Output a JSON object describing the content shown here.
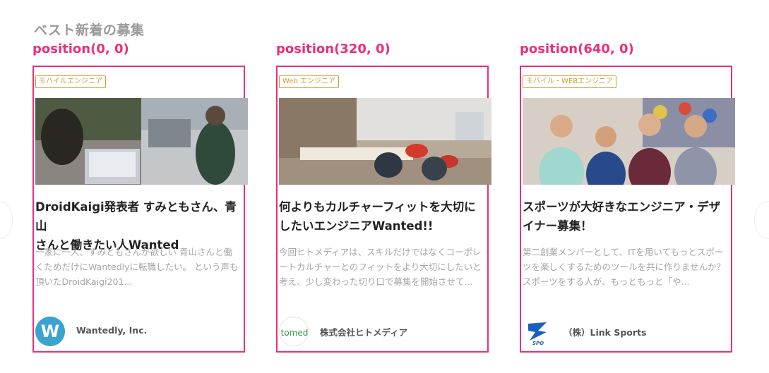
{
  "section": {
    "title": "ベスト新着の募集"
  },
  "cards": [
    {
      "position_label": "position(0, 0)",
      "tag": "モバイルエンジニア",
      "title_line1": "DroidKaigi発表者 すみともさん、青山",
      "title_line2": "さんと働きたい人Wanted",
      "desc_line1": "一家に一人、すみともさんが欲しい 青山さんと働",
      "desc_line2": "くためだけにWantedlyに転職したい。 という声も",
      "desc_line3": "頂いたDroidKaigi201...",
      "company": "Wantedly, Inc.",
      "logo_icon": "wantedly-w-icon",
      "logo_color": "#2f9ac9"
    },
    {
      "position_label": "position(320, 0)",
      "tag": "Web エンジニア",
      "title_line1": "何よりもカルチャーフィットを大切に",
      "title_line2": "したいエンジニアWanted!!",
      "desc_line1": "今回ヒトメディアは、スキルだけではなくコーポレ",
      "desc_line2": "ートカルチャーとのフィットをより大切にしたいと",
      "desc_line3": "考え、少し変わった切り口で募集を開始させて...",
      "company": "株式会社ヒトメディア",
      "logo_text": "tomed",
      "logo_color": "#2e9a4e"
    },
    {
      "position_label": "position(640, 0)",
      "tag": "モバイル・WEBエンジニア",
      "title_line1": "スポーツが大好きなエンジニア・デザ",
      "title_line2": "イナー募集！",
      "desc_line1": "第二創業メンバーとして、ITを用いてもっとスポー",
      "desc_line2": "ツを楽しくするためのツールを共に作りませんか？",
      "desc_line3": "スポーツをする人が、もっともっと「や...",
      "company": "（株）Link Sports",
      "logo_text": "SPO",
      "logo_color": "#1a5fbf"
    }
  ],
  "accent_color": "#ee2d7a"
}
